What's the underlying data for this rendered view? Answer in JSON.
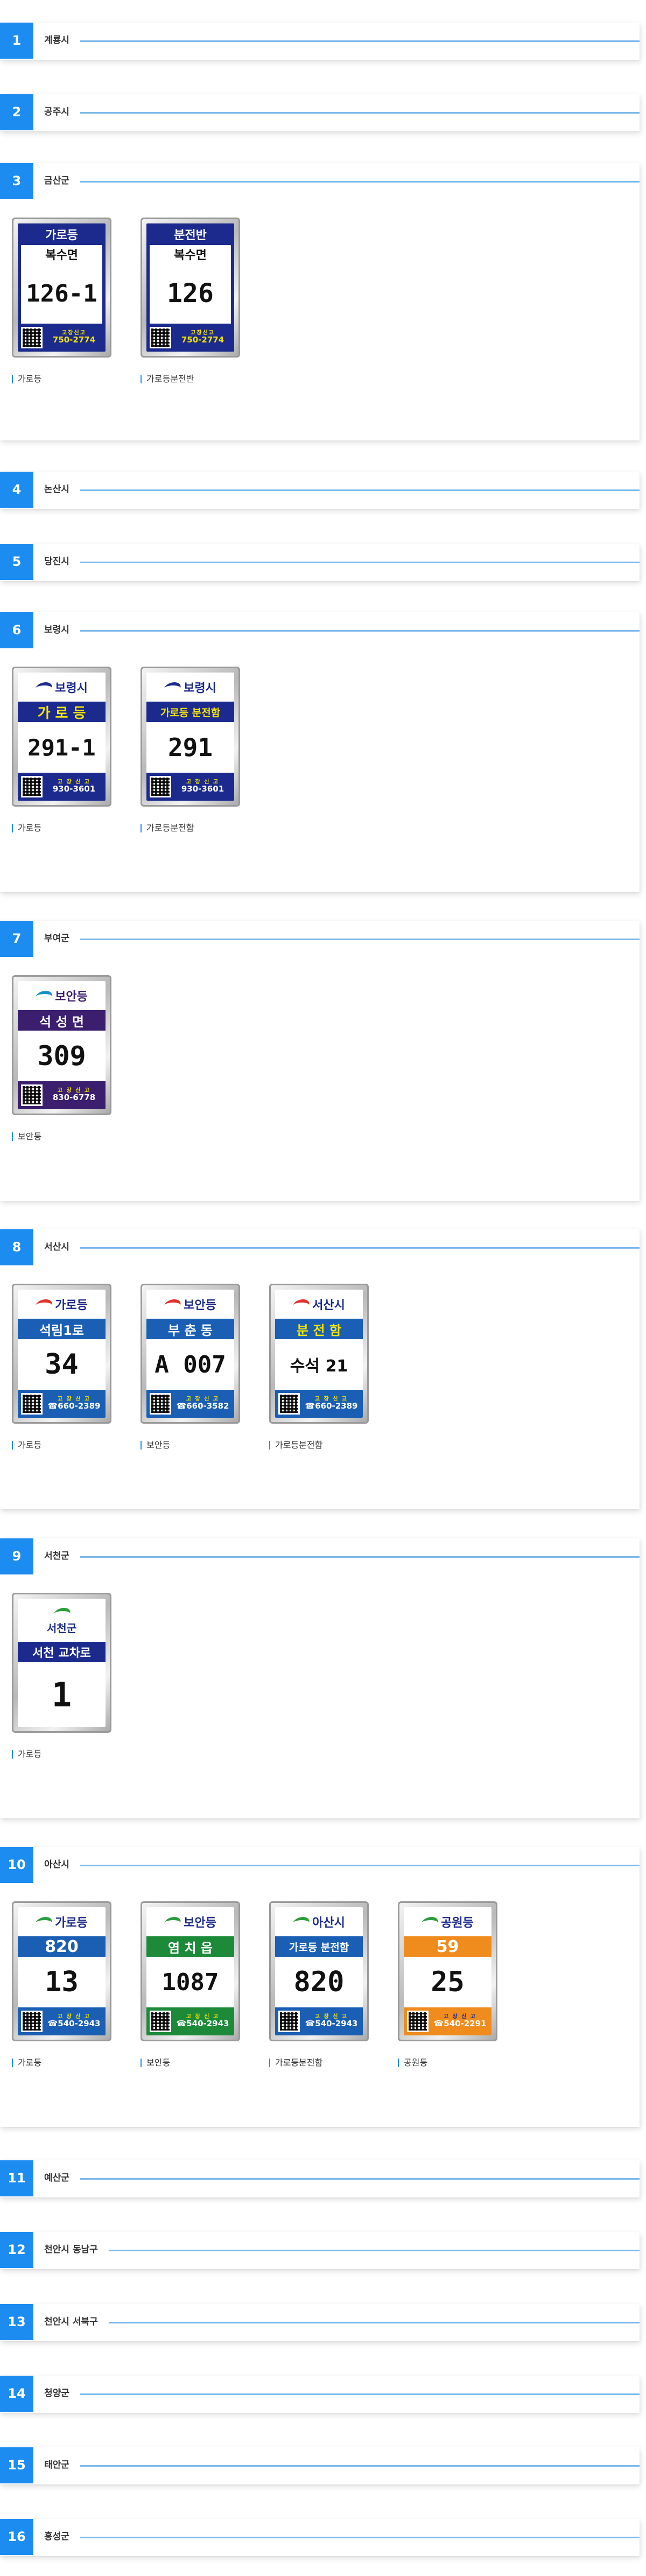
{
  "sections": [
    {
      "num": "1",
      "title": "계룡시"
    },
    {
      "num": "2",
      "title": "공주시"
    },
    {
      "num": "3",
      "title": "금산군",
      "items": [
        {
          "caption": "가로등",
          "header": "가로등",
          "sub": "복수면",
          "number": "126-1",
          "report_label": "고장신고",
          "phone": "750-2774"
        },
        {
          "caption": "가로등분전반",
          "header": "분전반",
          "sub": "복수면",
          "number": "126",
          "report_label": "고장신고",
          "phone": "750-2774"
        }
      ]
    },
    {
      "num": "4",
      "title": "논산시"
    },
    {
      "num": "5",
      "title": "당진시"
    },
    {
      "num": "6",
      "title": "보령시",
      "items": [
        {
          "caption": "가로등",
          "logo": "보령시",
          "sub": "가 로 등",
          "number": "291-1",
          "report_label": "고 장 신 고",
          "phone": "930-3601"
        },
        {
          "caption": "가로등분전함",
          "logo": "보령시",
          "sub": "가로등 분전함",
          "number": "291",
          "report_label": "고 장 신 고",
          "phone": "930-3601"
        }
      ]
    },
    {
      "num": "7",
      "title": "부여군",
      "items": [
        {
          "caption": "보안등",
          "logo": "보안등",
          "sub": "석 성 면",
          "number": "309",
          "report_label": "고 장 신 고",
          "phone": "830-6778"
        }
      ]
    },
    {
      "num": "8",
      "title": "서산시",
      "items": [
        {
          "caption": "가로등",
          "logo": "가로등",
          "sub": "석림1로",
          "number": "34",
          "report_label": "고 장 신 고",
          "phone": "☎660-2389"
        },
        {
          "caption": "보안등",
          "logo": "보안등",
          "sub": "부 춘 동",
          "number": "A 007",
          "report_label": "고 장 신 고",
          "phone": "☎660-3582"
        },
        {
          "caption": "가로등분전함",
          "logo": "서산시",
          "sub": "분 전 함",
          "number": "수석 21",
          "report_label": "고 장 신 고",
          "phone": "☎660-2389"
        }
      ]
    },
    {
      "num": "9",
      "title": "서천군",
      "items": [
        {
          "caption": "가로등",
          "logo": "서천군",
          "sub": "서천 교차로",
          "number": "1"
        }
      ]
    },
    {
      "num": "10",
      "title": "아산시",
      "items": [
        {
          "caption": "가로등",
          "logo": "가로등",
          "sub": "820",
          "number": "13",
          "report_label": "고 장 신 고",
          "phone": "☎540-2943"
        },
        {
          "caption": "보안등",
          "logo": "보안등",
          "sub": "염 치 읍",
          "number": "1087",
          "report_label": "고 장 신 고",
          "phone": "☎540-2943"
        },
        {
          "caption": "가로등분전함",
          "logo": "아산시",
          "sub": "가로등 분전함",
          "number": "820",
          "report_label": "고 장 신 고",
          "phone": "☎540-2943"
        },
        {
          "caption": "공원등",
          "logo": "공원등",
          "sub": "59",
          "number": "25",
          "report_label": "고 장 신 고",
          "phone": "☎540-2291"
        }
      ]
    },
    {
      "num": "11",
      "title": "예산군"
    },
    {
      "num": "12",
      "title": "천안시 동남구"
    },
    {
      "num": "13",
      "title": "천안시 서북구"
    },
    {
      "num": "14",
      "title": "청양군"
    },
    {
      "num": "15",
      "title": "태안군"
    },
    {
      "num": "16",
      "title": "홍성군"
    }
  ],
  "colors": {
    "accent": "#1c8cf0",
    "line": "#7bb8ec",
    "navy": "#1b2a8c",
    "yellow": "#f5e400",
    "purple": "#3b1f6e",
    "green": "#1d8a3a",
    "orange": "#f08c1e",
    "blue": "#1a5fb4"
  }
}
